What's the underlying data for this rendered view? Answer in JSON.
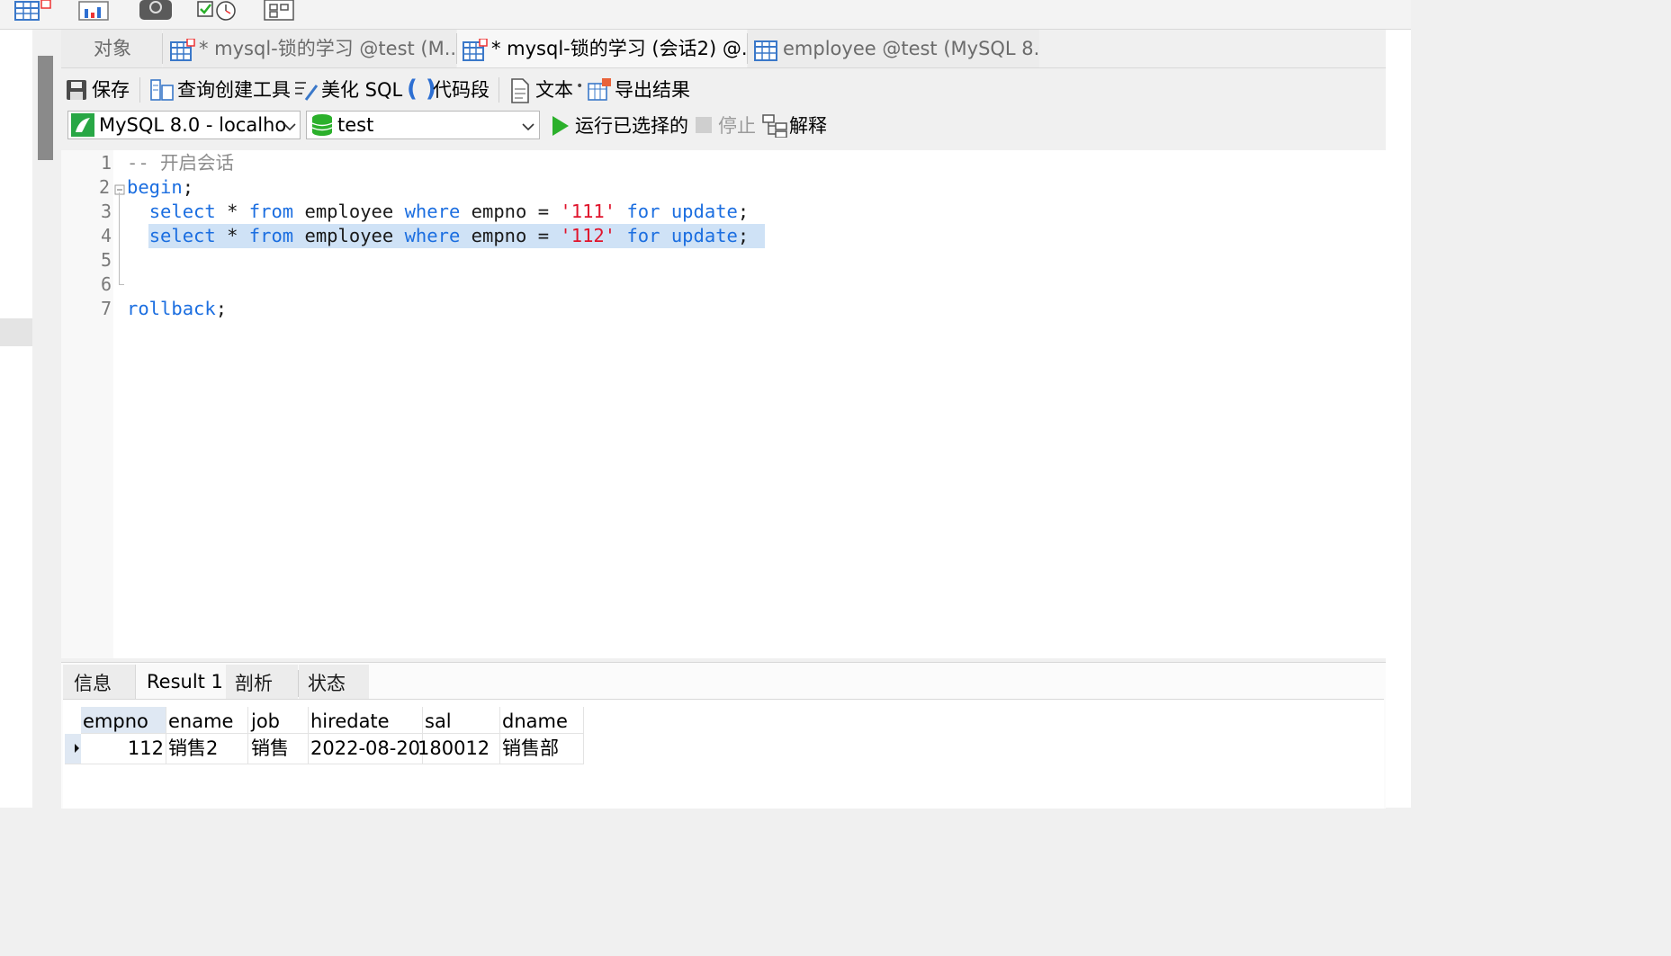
{
  "toolbar_icons": [
    "table-icon",
    "chart-icon",
    "query-icon",
    "schedule-icon",
    "model-icon"
  ],
  "tabs": [
    {
      "label": "对象",
      "state": "inactive"
    },
    {
      "label": "* mysql-锁的学习 @test (M...",
      "state": "inactive"
    },
    {
      "label": "* mysql-锁的学习 (会话2) @...",
      "state": "active"
    },
    {
      "label": "employee @test (MySQL 8....",
      "state": "inactive"
    }
  ],
  "editor_toolbar": {
    "save": "保存",
    "query_builder": "查询创建工具",
    "beautify": "美化 SQL",
    "snippet": "代码段",
    "text": "文本",
    "export": "导出结果"
  },
  "connection": {
    "value": "MySQL 8.0 - localho",
    "database": "test",
    "run_selected": "运行已选择的",
    "stop": "停止",
    "explain": "解释"
  },
  "editor": {
    "line_numbers": [
      "1",
      "2",
      "3",
      "4",
      "5",
      "6",
      "7"
    ],
    "line1_comment": "-- 开启会话",
    "line2_kw": "begin",
    "semi": ";",
    "select": "select",
    "star": "*",
    "from": "from",
    "table": "employee",
    "where": "where",
    "col": "empno",
    "eq": "=",
    "val3": "'111'",
    "val4": "'112'",
    "for": "for",
    "update": "update",
    "rollback": "rollback"
  },
  "result_tabs": [
    "信息",
    "Result 1",
    "剖析",
    "状态"
  ],
  "result": {
    "columns": [
      "empno",
      "ename",
      "job",
      "hiredate",
      "sal",
      "dname"
    ],
    "rows": [
      [
        "112",
        "销售2",
        "销售",
        "2022-08-20",
        "180012",
        "销售部"
      ]
    ]
  },
  "colors": {
    "keyword": "#1b6ee0",
    "string": "#e0142c",
    "comment": "#8d8d8d",
    "selection": "#cfe2f6",
    "run_green": "#2bb02b"
  }
}
